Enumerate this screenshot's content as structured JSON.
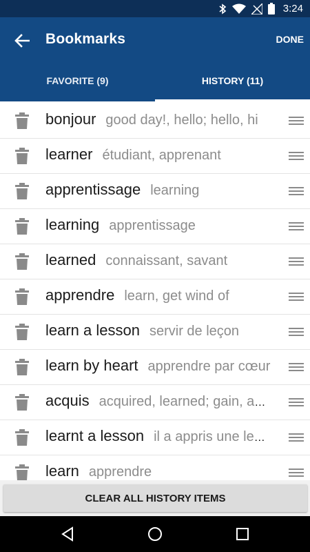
{
  "status_bar": {
    "time": "3:24"
  },
  "app_bar": {
    "title": "Bookmarks",
    "done_label": "DONE"
  },
  "tabs": [
    {
      "label": "FAVORITE (9)",
      "active": false
    },
    {
      "label": "HISTORY (11)",
      "active": true
    }
  ],
  "items": [
    {
      "word": "bonjour",
      "meaning": "good day!, hello; hello, hi"
    },
    {
      "word": "learner",
      "meaning": "étudiant, apprenant"
    },
    {
      "word": "apprentissage",
      "meaning": "learning"
    },
    {
      "word": "learning",
      "meaning": "apprentissage"
    },
    {
      "word": "learned",
      "meaning": "connaissant, savant"
    },
    {
      "word": "apprendre",
      "meaning": "learn, get wind of"
    },
    {
      "word": "learn a lesson",
      "meaning": "servir de leçon"
    },
    {
      "word": "learn by heart",
      "meaning": "apprendre par cœur"
    },
    {
      "word": "acquis",
      "meaning": "acquired, learned; gain, asset"
    },
    {
      "word": "learnt a lesson",
      "meaning": "il a appris une leçon"
    },
    {
      "word": "learn",
      "meaning": "apprendre"
    }
  ],
  "clear_button_label": "CLEAR ALL HISTORY ITEMS",
  "colors": {
    "status_bar": "#0d2f57",
    "app_bar": "#134a84"
  },
  "icons": {
    "back": "arrow-back-icon",
    "delete": "trash-icon",
    "reorder": "drag-handle-icon"
  }
}
